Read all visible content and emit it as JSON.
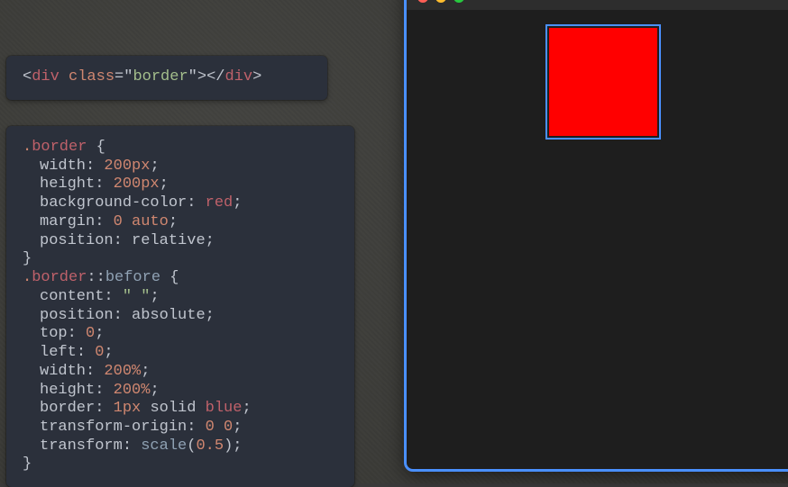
{
  "html_snippet": {
    "p_lt": "<",
    "tag_open": "div",
    "sp": " ",
    "attr": "class",
    "eq": "=",
    "q1": "\"",
    "classval": "border",
    "q2": "\"",
    "p_gt": ">",
    "p_lt2": "</",
    "tag_close": "div",
    "p_gt2": ">"
  },
  "css": {
    "rule1": {
      "dot": ".",
      "sel": "border",
      "sp": " ",
      "ob": "{",
      "l1p": "width",
      "l1c": ": ",
      "l1v": "200",
      "l1u": "px",
      "l1s": ";",
      "l2p": "height",
      "l2c": ": ",
      "l2v": "200",
      "l2u": "px",
      "l2s": ";",
      "l3p": "background-color",
      "l3c": ": ",
      "l3v": "red",
      "l3s": ";",
      "l4p": "margin",
      "l4c": ": ",
      "l4v1": "0",
      "l4sp": " ",
      "l4v2": "auto",
      "l4s": ";",
      "l5p": "position",
      "l5c": ": ",
      "l5v": "relative",
      "l5s": ";",
      "cb": "}"
    },
    "rule2": {
      "dot": ".",
      "sel": "border",
      "pseudo": "::",
      "pname": "before",
      "sp": " ",
      "ob": "{",
      "l1p": "content",
      "l1c": ": ",
      "l1v": "\" \"",
      "l1s": ";",
      "l2p": "position",
      "l2c": ": ",
      "l2v": "absolute",
      "l2s": ";",
      "l3p": "top",
      "l3c": ": ",
      "l3v": "0",
      "l3s": ";",
      "l4p": "left",
      "l4c": ": ",
      "l4v": "0",
      "l4s": ";",
      "l5p": "width",
      "l5c": ": ",
      "l5v": "200",
      "l5u": "%",
      "l5s": ";",
      "l6p": "height",
      "l6c": ": ",
      "l6v": "200",
      "l6u": "%",
      "l6s": ";",
      "l7p": "border",
      "l7c": ": ",
      "l7v1": "1",
      "l7u": "px",
      "l7sp1": " ",
      "l7v2": "solid",
      "l7sp2": " ",
      "l7v3": "blue",
      "l7s": ";",
      "l8p": "transform-origin",
      "l8c": ": ",
      "l8v1": "0",
      "l8sp": " ",
      "l8v2": "0",
      "l8s": ";",
      "l9p": "transform",
      "l9c": ": ",
      "l9f": "scale",
      "l9po": "(",
      "l9v": "0.5",
      "l9pc": ")",
      "l9s": ";",
      "cb": "}"
    }
  },
  "preview": {
    "box_color": "red",
    "border_color": "#4a90ff"
  }
}
